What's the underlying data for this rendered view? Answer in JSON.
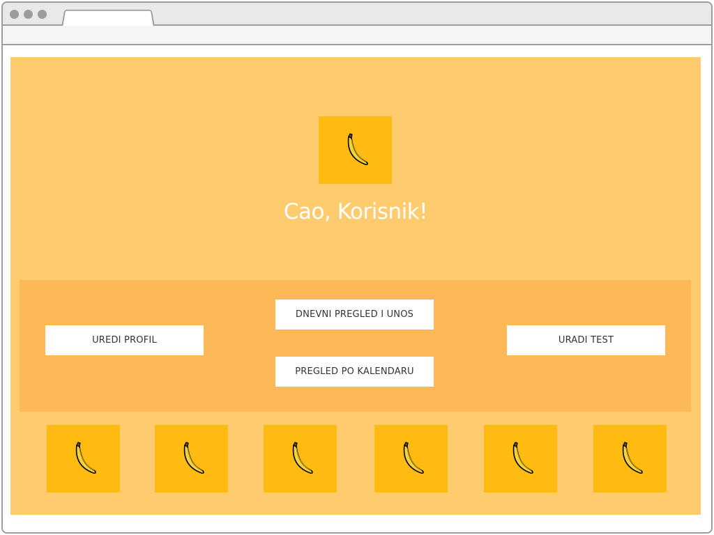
{
  "hero": {
    "greeting": "Cao, Korisnik!",
    "logo_icon": "banana-icon"
  },
  "nav": {
    "profile_label": "UREDI PROFIL",
    "daily_label": "DNEVNI PREGLED I UNOS",
    "calendar_label": "PREGLED PO KALENDARU",
    "test_label": "URADI TEST"
  },
  "tiles": [
    {
      "icon": "banana-icon"
    },
    {
      "icon": "banana-icon"
    },
    {
      "icon": "banana-icon"
    },
    {
      "icon": "banana-icon"
    },
    {
      "icon": "banana-icon"
    },
    {
      "icon": "banana-icon"
    }
  ],
  "colors": {
    "page_background": "#fecb6e",
    "panel_background": "#fdb858",
    "tile_background": "#ffbb12",
    "greeting_text": "#ffffff"
  }
}
